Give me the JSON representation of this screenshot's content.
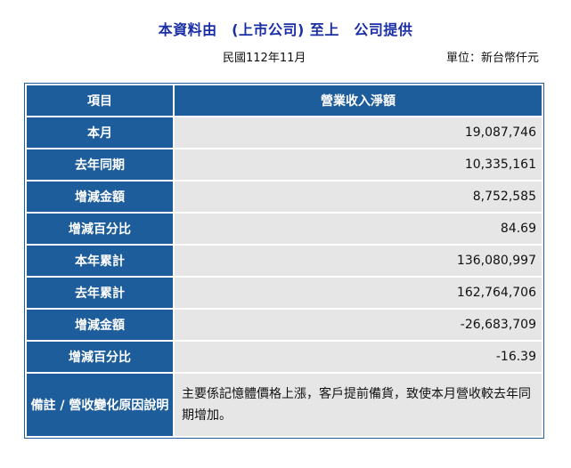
{
  "header": {
    "title": "本資料由　(上市公司) 至上　公司提供",
    "date": "民國112年11月",
    "unit": "單位：新台幣仟元"
  },
  "table": {
    "headers": [
      "項目",
      "營業收入淨額"
    ],
    "rows": [
      {
        "label": "本月",
        "value": "19,087,746"
      },
      {
        "label": "去年同期",
        "value": "10,335,161"
      },
      {
        "label": "增減金額",
        "value": "8,752,585"
      },
      {
        "label": "增減百分比",
        "value": "84.69"
      },
      {
        "label": "本年累計",
        "value": "136,080,997"
      },
      {
        "label": "去年累計",
        "value": "162,764,706"
      },
      {
        "label": "增減金額",
        "value": "-26,683,709"
      },
      {
        "label": "增減百分比",
        "value": "-16.39"
      }
    ],
    "note": {
      "label": "備註 / 營收變化原因說明",
      "text": "主要係記憶體價格上漲，客戶提前備貨，致使本月營收較去年同期增加。"
    }
  },
  "colors": {
    "header_blue": "#1e5d9b",
    "title_blue": "#1a2fa6",
    "cell_gray": "#e6e6e6"
  }
}
